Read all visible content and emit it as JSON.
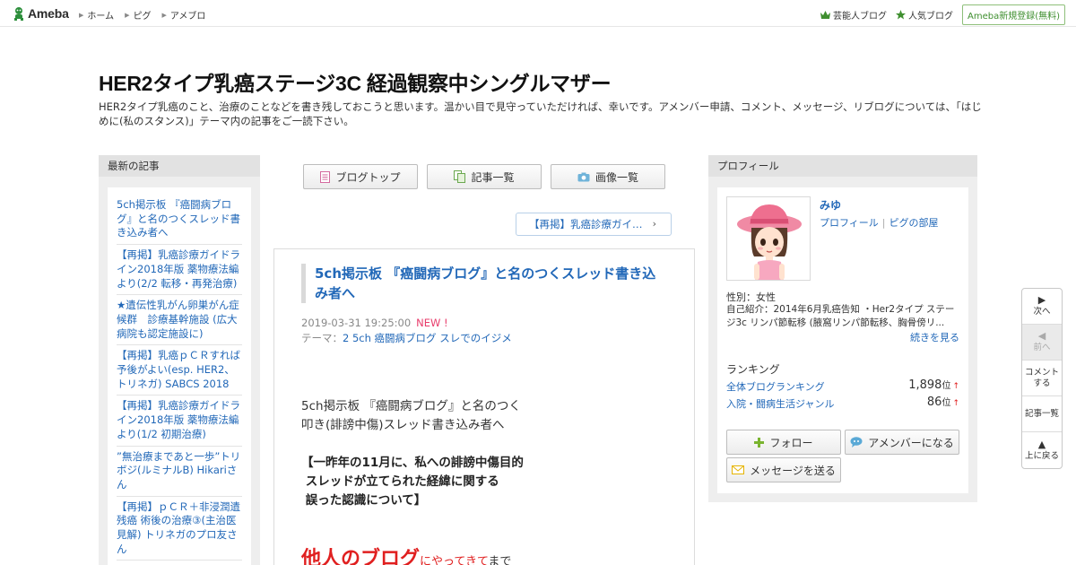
{
  "topbar": {
    "logo_text": "Ameba",
    "nav": [
      "ホーム",
      "ピグ",
      "アメブロ"
    ],
    "right_links": [
      "芸能人ブログ",
      "人気ブログ"
    ],
    "signup": "Ameba新規登録(無料)"
  },
  "header": {
    "title": "HER2タイプ乳癌ステージ3C 経過観察中シングルマザー",
    "description": "HER2タイプ乳癌のこと、治療のことなどを書き残しておこうと思います。温かい目で見守っていただければ、幸いです。アメンバー申請、コメント、メッセージ、リブログについては、「はじめに(私のスタンス)」テーマ内の記事をご一読下さい。"
  },
  "left": {
    "header": "最新の記事",
    "items": [
      "5ch掲示板 『癌闘病ブログ』と名のつくスレッド書き込み者へ",
      "【再掲】乳癌診療ガイドライン2018年版 薬物療法編より(2/2 転移・再発治療)",
      "★遺伝性乳がん卵巣がん症候群　診療基幹施設 (広大病院も認定施設に)",
      "【再掲】乳癌ｐＣＲすれば予後がよい(esp. HER2、トリネガ) SABCS 2018",
      "【再掲】乳癌診療ガイドライン2018年版 薬物療法編より(1/2 初期治療)",
      "”無治療まであと一歩”トリボジ(ルミナルB) Hikariさん",
      "【再掲】ｐＣＲ＋非浸潤遺残癌 術後の治療③(主治医見解) トリネガのプロ友さん"
    ]
  },
  "center": {
    "tabs": [
      "ブログトップ",
      "記事一覧",
      "画像一覧"
    ],
    "prev_entry": "【再掲】乳癌診療ガイ…",
    "article": {
      "title": "5ch掲示板 『癌闘病ブログ』と名のつくスレッド書き込み者へ",
      "date": "2019-03-31 19:25:00",
      "new_tag": "NEW !",
      "theme_label": "テーマ：",
      "theme": "2 5ch 癌闘病ブログ スレでのイジメ",
      "para1_line1": "5ch掲示板 『癌闘病ブログ』と名のつく",
      "para1_line2": "叩き(誹謗中傷)スレッド書き込み者へ",
      "para2_line1": "【一昨年の11月に、私への誹謗中傷目的",
      "para2_line2": " スレッドが立てられた経緯に関する",
      "para2_line3": " 誤った認識について】",
      "big_red": "他人のブログ",
      "small_red": "にやってきて",
      "tail": "まで"
    }
  },
  "profile": {
    "header": "プロフィール",
    "name": "みゆ",
    "link1": "プロフィール",
    "link2": "ピグの部屋",
    "gender": "性別：女性",
    "intro": "自己紹介：2014年6月乳癌告知 ・Her2タイプ ステージ3c リンパ節転移 (腋窩リンパ節転移、胸骨傍リ...",
    "more": "続きを見る",
    "ranking_title": "ランキング",
    "rankings": [
      {
        "label": "全体ブログランキング",
        "value": "1,898",
        "unit": "位",
        "trend": "↑"
      },
      {
        "label": "入院・闘病生活ジャンル",
        "value": "86",
        "unit": "位",
        "trend": "↑"
      }
    ],
    "follow": "フォロー",
    "amember": "アメンバーになる",
    "message": "メッセージを送る"
  },
  "sidenav": {
    "next": "次へ",
    "prev": "前へ",
    "comment_l1": "コメント",
    "comment_l2": "する",
    "list": "記事一覧",
    "top": "上に戻る"
  },
  "colors": {
    "link": "#2268b8",
    "accent_green": "#3f8f2f",
    "red": "#e02020",
    "new_pink": "#e83c6b"
  }
}
